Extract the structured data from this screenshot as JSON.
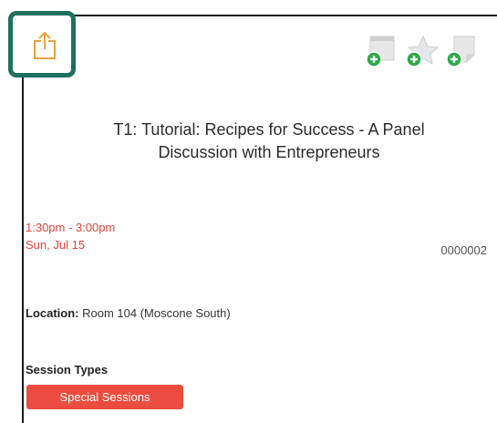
{
  "session": {
    "title_line1": "T1: Tutorial: Recipes for Success - A Panel",
    "title_line2": "Discussion with Entrepreneurs",
    "time_range": "1:30pm - 3:00pm",
    "date": "Sun, Jul 15",
    "code": "0000002",
    "location_label": "Location:",
    "location_value": "Room 104 (Moscone South)",
    "session_types_label": "Session Types",
    "session_type": "Special Sessions"
  },
  "icons": {
    "share": "share-icon",
    "add_to_schedule": "add-to-schedule-icon",
    "add_favorite": "add-favorite-icon",
    "add_note": "add-note-icon"
  },
  "colors": {
    "accent_red": "#ea4d3f",
    "share_orange": "#f2a03b",
    "add_green": "#2ea84a",
    "highlight_border": "#1f6f5b"
  }
}
